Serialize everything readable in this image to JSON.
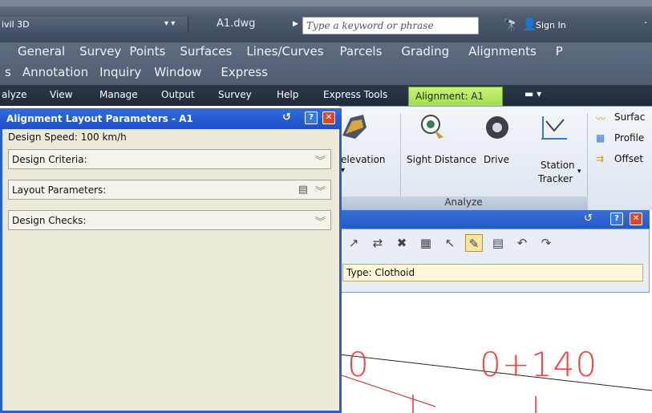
{
  "titlebar": {
    "app_name": "ivil 3D",
    "filename": "A1.dwg",
    "search_placeholder": "Type a keyword or phrase",
    "sign_in": "Sign In"
  },
  "menu": {
    "row1": [
      "General",
      "Survey",
      "Points",
      "Surfaces",
      "Lines/Curves",
      "Parcels",
      "Grading",
      "Alignments",
      "P"
    ],
    "row2": [
      "s",
      "Annotation",
      "Inquiry",
      "Window",
      "Express"
    ]
  },
  "ribbon_tabs": [
    "alyze",
    "View",
    "Manage",
    "Output",
    "Survey",
    "Help",
    "Express Tools"
  ],
  "ribbon_active_tab": "Alignment: A1",
  "ribbon": {
    "elevation": "elevation",
    "sight_distance": "Sight Distance",
    "drive": "Drive",
    "station": "Station",
    "tracker": "Tracker",
    "surface": "Surfac",
    "profile": "Profile",
    "offset": "Offset",
    "group_label": "Analyze"
  },
  "layout_panel": {
    "title": "Alignment Layout Parameters - A1",
    "design_speed": "Design Speed: 100 km/h",
    "sections": [
      "Design Criteria:",
      "Layout Parameters:",
      "Design Checks:"
    ]
  },
  "toolbar_window": {
    "type_field": "Type: Clothoid"
  },
  "drawing": {
    "station_label": "0+140",
    "left_label": "0"
  }
}
